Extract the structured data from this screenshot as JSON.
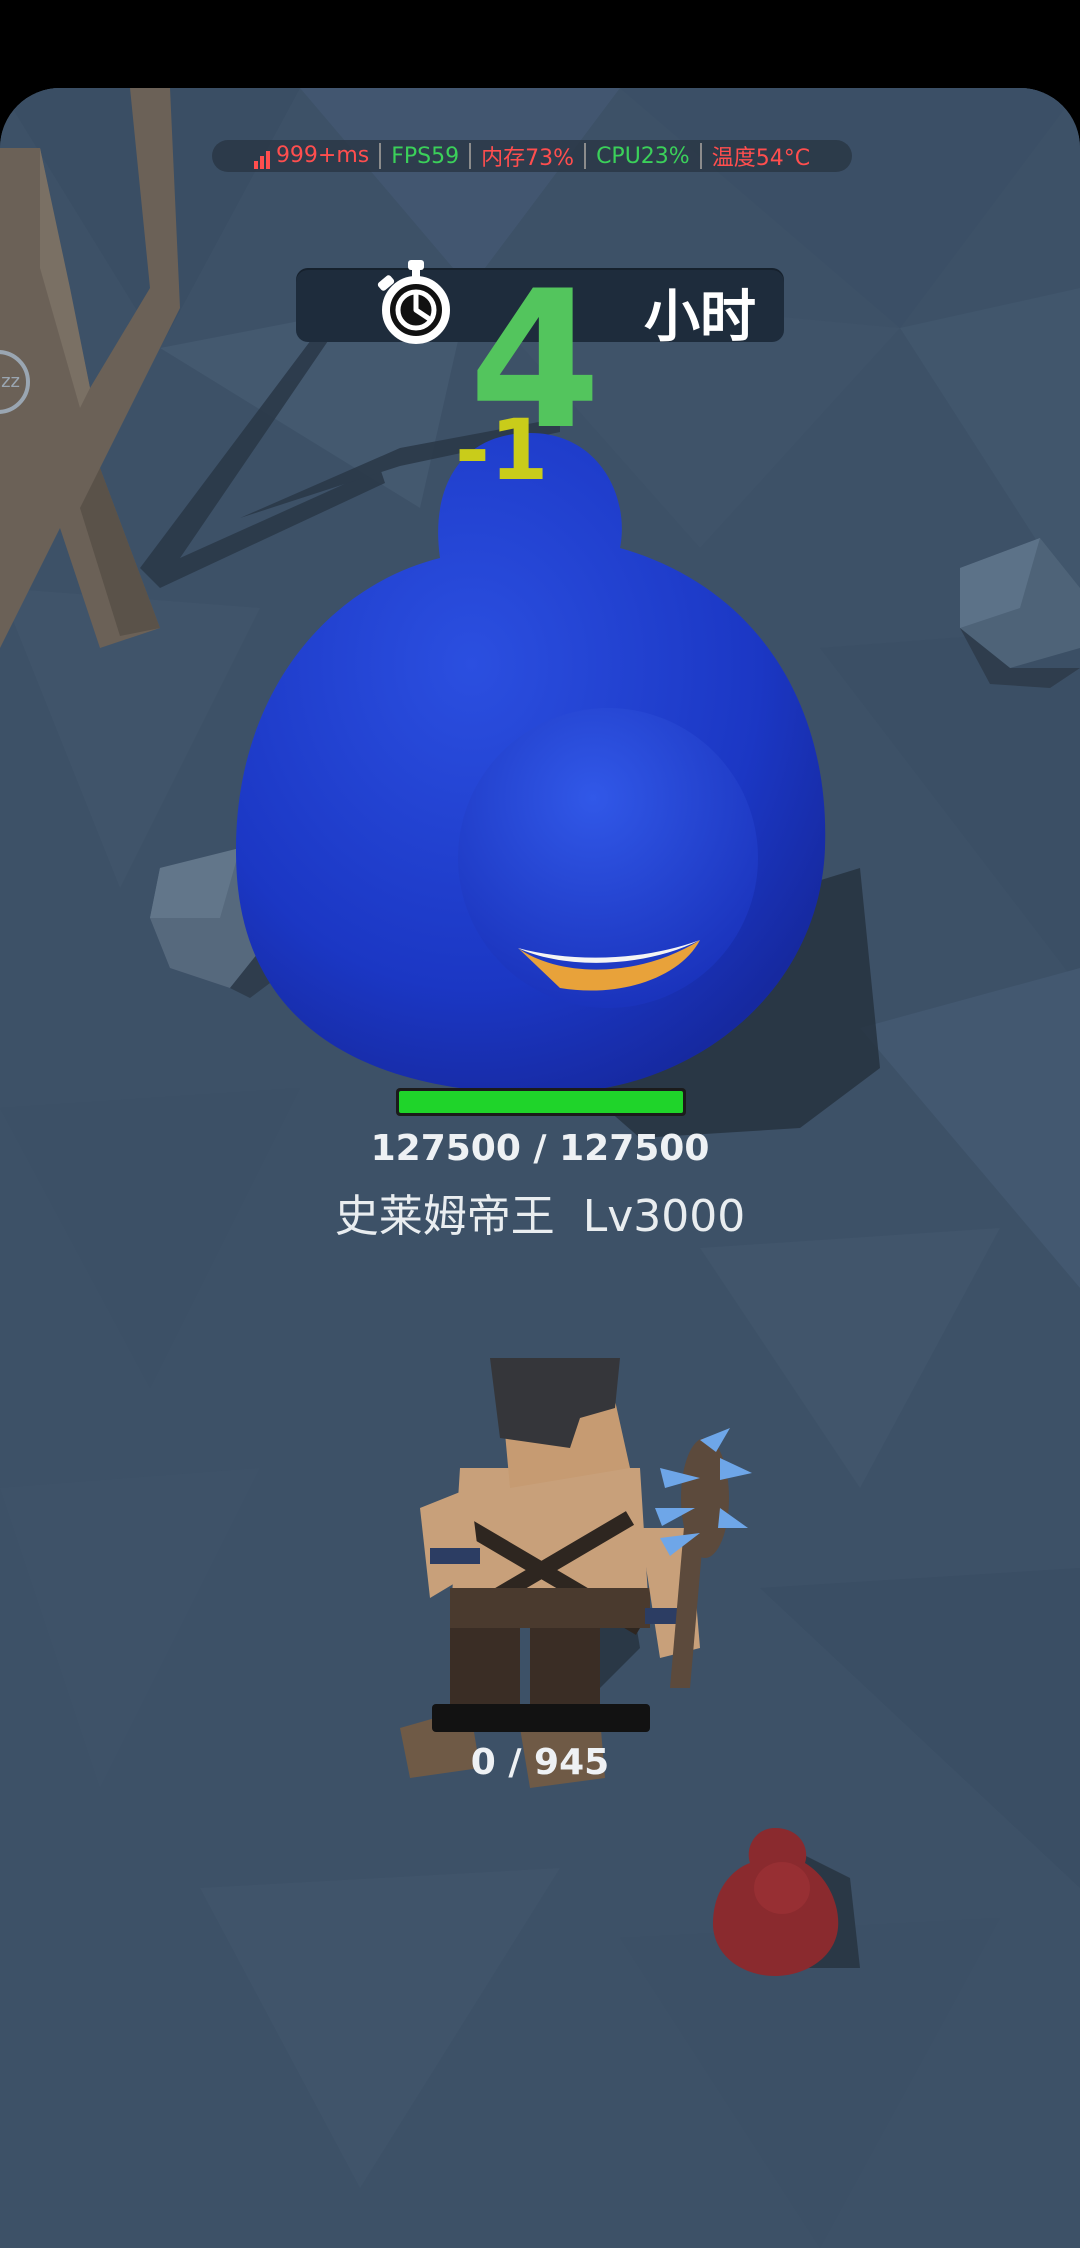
{
  "perf": {
    "ping": "999+ms",
    "fps": "FPS59",
    "memory": "内存73%",
    "cpu": "CPU23%",
    "temperature": "温度54°C",
    "colors": {
      "ping": "#ff4e4e",
      "fps": "#3bd05a",
      "memory": "#ff4e4e",
      "cpu": "#3bd05a",
      "temperature": "#ff4e4e"
    }
  },
  "timer": {
    "number": "4",
    "unit": "小时",
    "icon": "stopwatch-icon"
  },
  "damage_popup": "-1",
  "boss": {
    "hp_text": "127500 / 127500",
    "hp_fraction": 1.0,
    "name": "史莱姆帝王",
    "level": "Lv3000",
    "color": "#1d3ec8"
  },
  "player": {
    "hp_text": "0 / 945",
    "hp_fraction": 0.0
  },
  "side_button_text": "zz",
  "colors": {
    "ground": "#3d5167",
    "hp_green": "#1fd42a",
    "timer_green": "#53c55d",
    "damage_yellow": "#c9cc1a",
    "red_slime": "#8a2a2e"
  }
}
